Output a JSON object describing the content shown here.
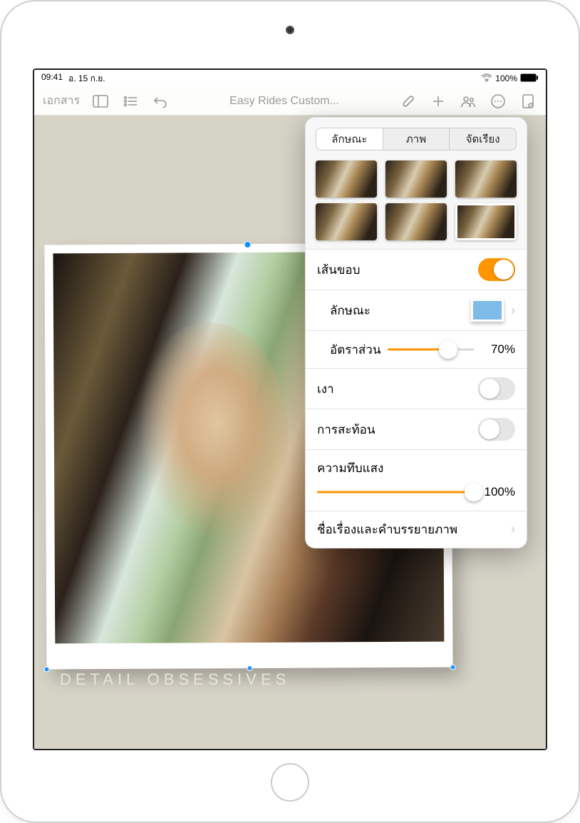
{
  "status": {
    "time": "09:41",
    "date": "อ. 15 ก.ย.",
    "battery": "100%"
  },
  "toolbar": {
    "back_label": "เอกสาร",
    "document_title": "Easy Rides Custom..."
  },
  "canvas": {
    "caption": "DETAIL OBSESSIVES"
  },
  "popover": {
    "tabs": {
      "style": "ลักษณะ",
      "image": "ภาพ",
      "arrange": "จัดเรียง"
    },
    "border": {
      "label": "เส้นขอบ",
      "on": true
    },
    "style": {
      "label": "ลักษณะ"
    },
    "scale": {
      "label": "อัตราส่วน",
      "value": 70,
      "display": "70%"
    },
    "shadow": {
      "label": "เงา",
      "on": false
    },
    "reflection": {
      "label": "การสะท้อน",
      "on": false
    },
    "opacity": {
      "label": "ความทึบแสง",
      "value": 100,
      "display": "100%"
    },
    "title_caption": {
      "label": "ชื่อเรื่องและคำบรรยายภาพ"
    }
  }
}
